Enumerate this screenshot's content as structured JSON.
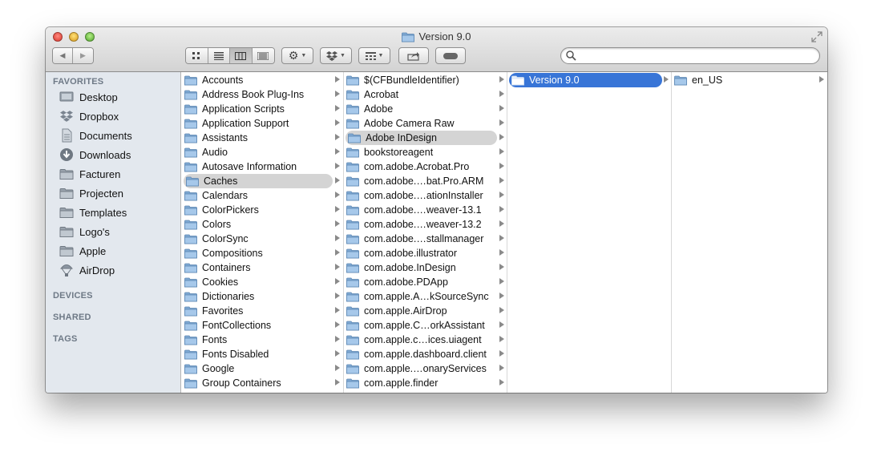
{
  "window": {
    "title": "Version 9.0"
  },
  "toolbar": {
    "back_label": "◀",
    "forward_label": "▶",
    "view_icons": [
      "icon-view-icon",
      "list-view-icon",
      "column-view-icon",
      "coverflow-view-icon"
    ],
    "search_placeholder": ""
  },
  "sidebar": {
    "favorites_label": "FAVORITES",
    "favorites": [
      {
        "label": "Desktop",
        "icon": "desktop-icon"
      },
      {
        "label": "Dropbox",
        "icon": "dropbox-icon"
      },
      {
        "label": "Documents",
        "icon": "documents-icon"
      },
      {
        "label": "Downloads",
        "icon": "downloads-icon"
      },
      {
        "label": "Facturen",
        "icon": "folder-icon"
      },
      {
        "label": "Projecten",
        "icon": "folder-icon"
      },
      {
        "label": "Templates",
        "icon": "folder-icon"
      },
      {
        "label": "Logo's",
        "icon": "folder-icon"
      },
      {
        "label": "Apple",
        "icon": "folder-icon"
      },
      {
        "label": "AirDrop",
        "icon": "airdrop-icon"
      }
    ],
    "devices_label": "DEVICES",
    "shared_label": "SHARED",
    "tags_label": "TAGS"
  },
  "columns": [
    {
      "items": [
        "Accounts",
        "Address Book Plug-Ins",
        "Application Scripts",
        "Application Support",
        "Assistants",
        "Audio",
        "Autosave Information",
        "Caches",
        "Calendars",
        "ColorPickers",
        "Colors",
        "ColorSync",
        "Compositions",
        "Containers",
        "Cookies",
        "Dictionaries",
        "Favorites",
        "FontCollections",
        "Fonts",
        "Fonts Disabled",
        "Google",
        "Group Containers"
      ],
      "selected": 7
    },
    {
      "items": [
        "$(CFBundleIdentifier)",
        "Acrobat",
        "Adobe",
        "Adobe Camera Raw",
        "Adobe InDesign",
        "bookstoreagent",
        "com.adobe.Acrobat.Pro",
        "com.adobe.…bat.Pro.ARM",
        "com.adobe.…ationInstaller",
        "com.adobe.…weaver-13.1",
        "com.adobe.…weaver-13.2",
        "com.adobe.…stallmanager",
        "com.adobe.illustrator",
        "com.adobe.InDesign",
        "com.adobe.PDApp",
        "com.apple.A…kSourceSync",
        "com.apple.AirDrop",
        "com.apple.C…orkAssistant",
        "com.apple.c…ices.uiagent",
        "com.apple.dashboard.client",
        "com.apple.…onaryServices",
        "com.apple.finder"
      ],
      "selected": 4
    },
    {
      "items": [
        "Version 9.0"
      ],
      "selected": 0
    },
    {
      "items": [
        "en_US"
      ],
      "selected": -1
    }
  ],
  "colors": {
    "selection_blue": "#3875d7",
    "selection_grey": "#d4d4d4",
    "sidebar_bg": "#e3e8ee",
    "folder_blue": "#8fb8e0"
  }
}
